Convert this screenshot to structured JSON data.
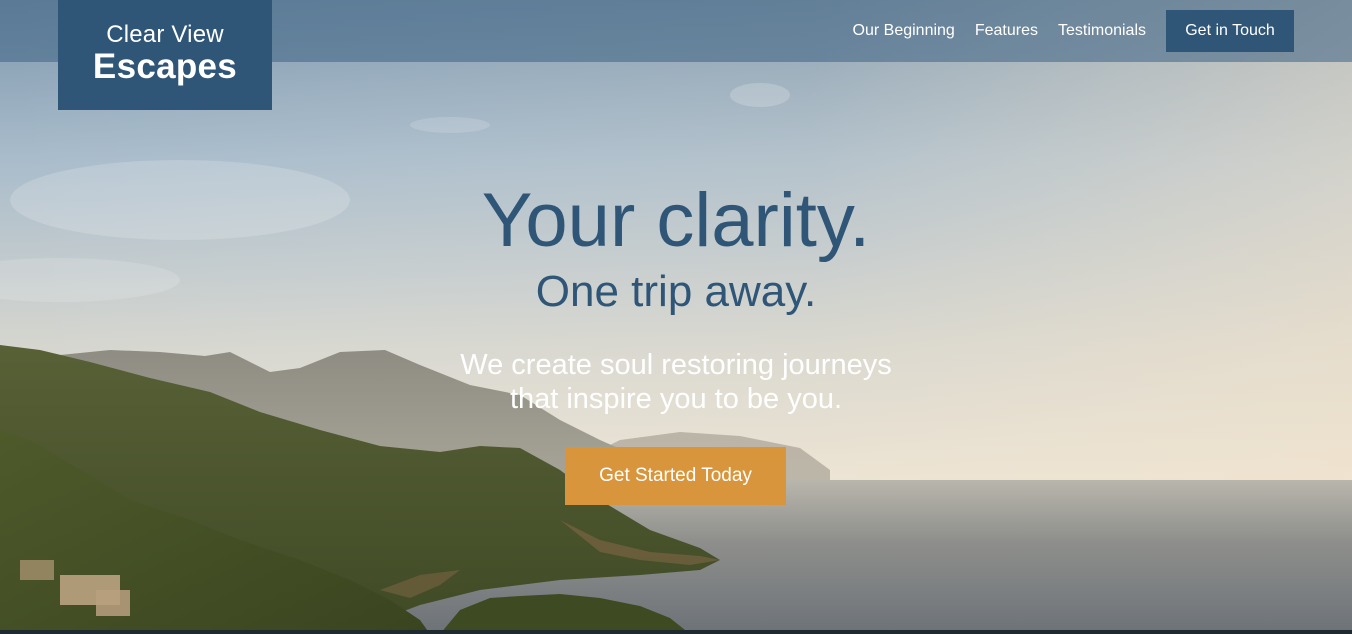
{
  "brand": {
    "line1": "Clear View",
    "line2": "Escapes"
  },
  "nav": {
    "items": [
      {
        "label": "Our Beginning"
      },
      {
        "label": "Features"
      },
      {
        "label": "Testimonials"
      }
    ],
    "cta_label": "Get in Touch"
  },
  "hero": {
    "headline": "Your clarity.",
    "subheadline": "One trip away.",
    "tagline_line1": "We create soul restoring journeys",
    "tagline_line2": "that inspire you to be you.",
    "cta_label": "Get Started Today",
    "background": "coastal-mountains-sea-photo"
  },
  "colors": {
    "brand_blue": "#2f5577",
    "accent_orange": "#d8953c",
    "text_white": "#ffffff"
  }
}
